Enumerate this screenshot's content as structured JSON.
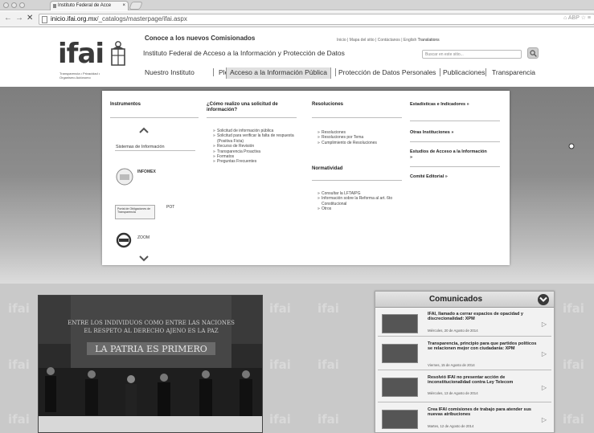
{
  "browser": {
    "tab_title": "Instituto Federal de Acce",
    "tab_close": "×",
    "url_host": "inicio.ifai.org.mx",
    "url_path": "/_catalogs/masterpage/ifai.aspx",
    "nav_back": "←",
    "nav_forward": "→",
    "nav_reload": "✕",
    "right_cluster": "⌂ ABP ☆ ≡"
  },
  "header": {
    "logo_text": "ifai",
    "logo_tagline": "Transparencia • Privacidad • Organismo Autónomo",
    "headline": "Conoce a los nuevos Comisionados",
    "institution": "Instituto Federal de Acceso a la Información y Protección de Datos",
    "util_links": [
      "Inicio",
      "Mapa del sitio",
      "Contáctanos",
      "English"
    ],
    "util_translations": "Translations",
    "search_placeholder": "Buscar en este sitio...",
    "nav": [
      "Nuestro Instituto",
      "Pleno",
      "Acceso a la Información Pública",
      "Protección de Datos Personales",
      "Publicaciones",
      "Transparencia"
    ]
  },
  "mega_menu": {
    "col1_heading": "Instrumentos",
    "col1_sistemas": "Sistemas de Información",
    "col1_infomex": "INFOMEX",
    "col1_pot_box": "Portal de Obligaciones de Transparencia",
    "col1_pot": "POT",
    "col1_zoom": "ZOOM",
    "col2_heading": "¿Cómo realizo una solicitud de información?",
    "col2_items": [
      "Solicitud de información pública",
      "Solicitud para verificar la falta de respuesta (Positiva Ficta)",
      "Recurso de Revisión",
      "Transparencia Proactiva",
      "Formatos",
      "Preguntas Frecuentes"
    ],
    "col3_heading": "Resoluciones",
    "col3_items": [
      "Resoluciones",
      "Resoluciones por Tema",
      "Cumplimiento de Resoluciones"
    ],
    "col3b_heading": "Normatividad",
    "col3b_items": [
      "Consultar la LFTAIPG",
      "Información sobre la Reforma al art. 6to Constitucional",
      "Otros"
    ],
    "col4_links": [
      "Estadísticas e Indicadores",
      "Otras Instituciones",
      "Estudios de Acceso a la Información",
      "Comité Editorial"
    ],
    "arrow": "»"
  },
  "photo": {
    "inscription_1": "ENTRE LOS INDIVIDUOS COMO ENTRE LAS NACIONES",
    "inscription_2": "EL RESPETO AL DERECHO AJENO ES LA PAZ",
    "inscription_main": "LA PATRIA ES PRIMERO"
  },
  "watermark": "ifai",
  "comunicados": {
    "title": "Comunicados",
    "arrow": "▷",
    "items": [
      {
        "headline": "IFAI, llamado a cerrar espacios de opacidad y discrecionalidad: XPM",
        "date": "Miércoles, 20 de Agosto de 2014"
      },
      {
        "headline": "Transparencia, principio para que partidos políticos se relacionen mejor con ciudadanía: XPM",
        "date": "Viernes, 15 de Agosto de 2014"
      },
      {
        "headline": "Resolvió IFAI no presentar acción de inconstitucionalidad contra Ley Telecom",
        "date": "Miércoles, 13 de Agosto de 2014"
      },
      {
        "headline": "Crea IFAI comisiones de trabajo para atender sus nuevas atribuciones",
        "date": "Martes, 12 de Agosto de 2014"
      }
    ]
  }
}
